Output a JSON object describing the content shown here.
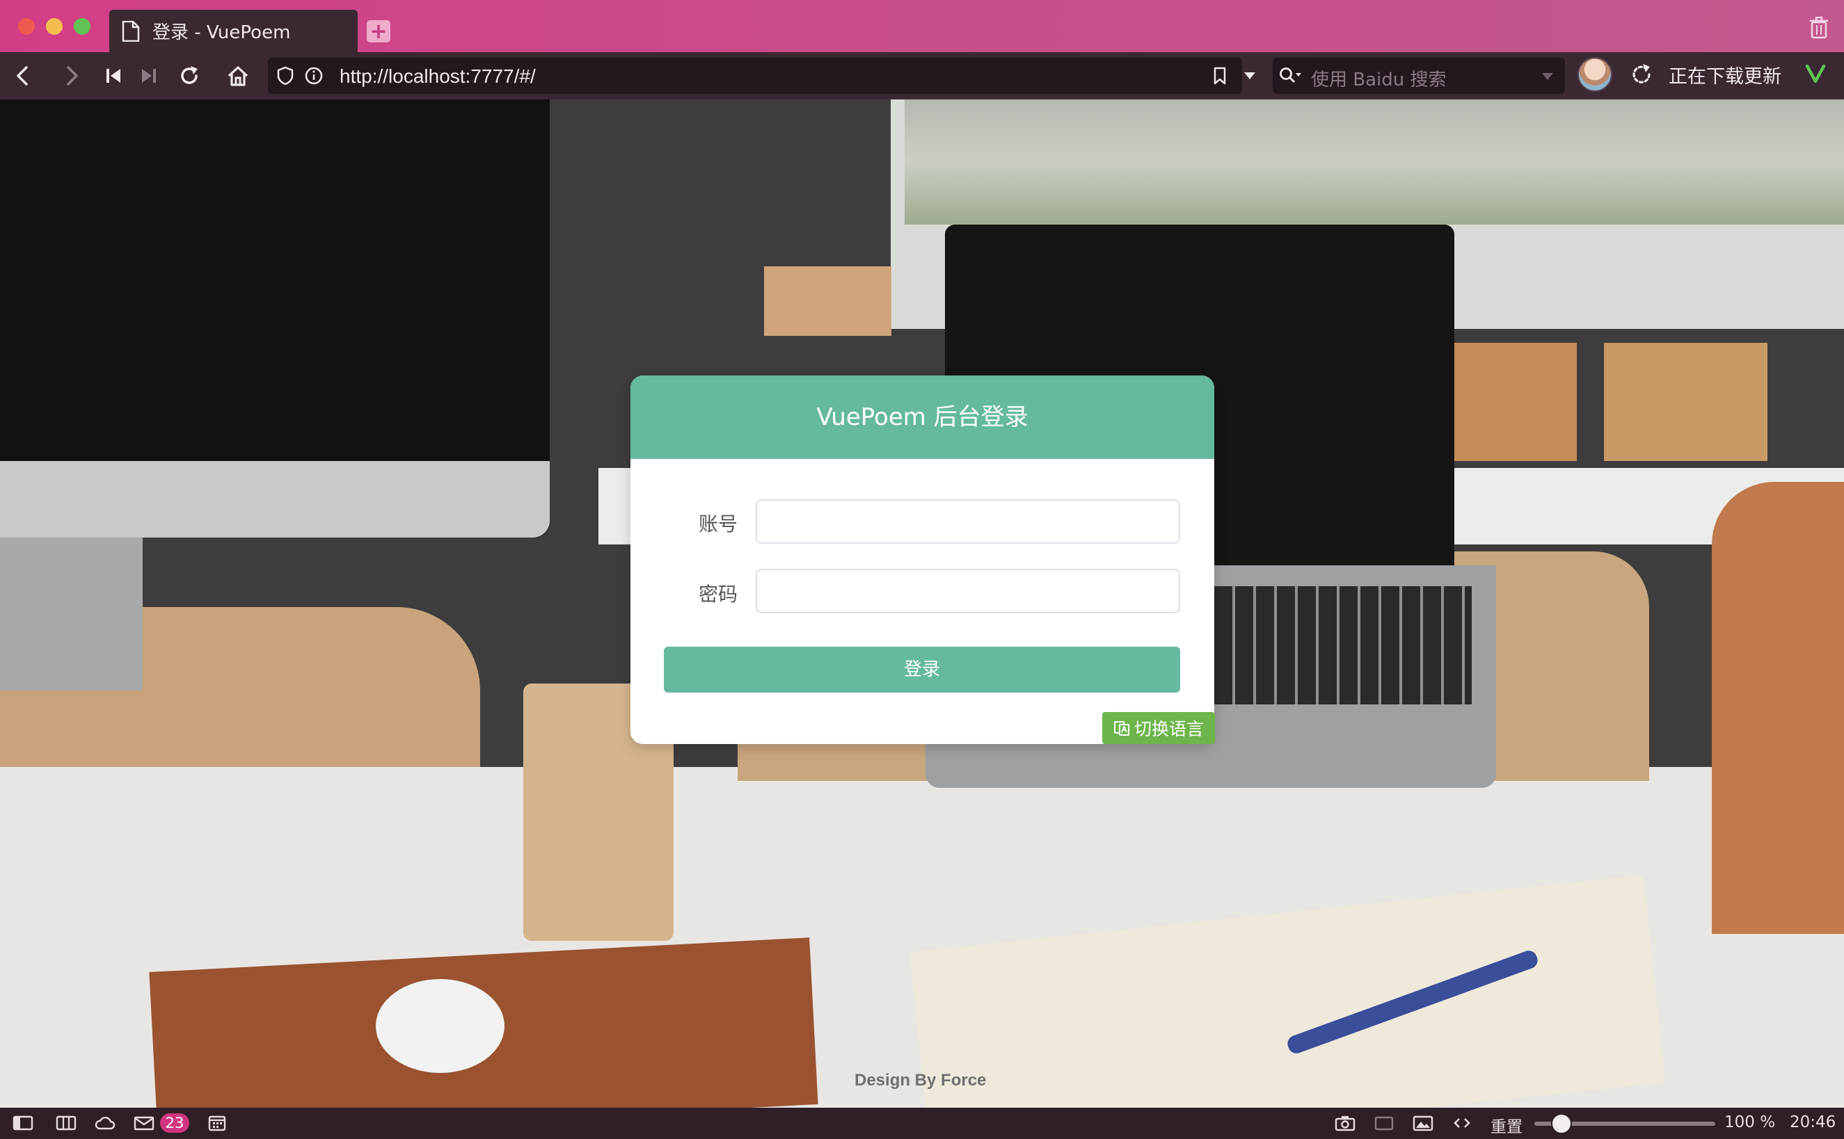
{
  "browser": {
    "tab_title": "登录 - VuePoem",
    "new_tab_label": "+",
    "url": "http://localhost:7777/#/",
    "search_placeholder": "使用 Baidu 搜索",
    "update_status": "正在下载更新",
    "icons": [
      "back-icon",
      "forward-icon",
      "first-icon",
      "last-icon",
      "reload-icon",
      "home-icon",
      "shield-icon",
      "info-icon",
      "bookmark-icon",
      "dropdown-icon",
      "search-icon",
      "avatar",
      "reload-status-icon",
      "vivaldi-logo"
    ]
  },
  "login": {
    "title": "VuePoem 后台登录",
    "account_label": "账号",
    "account_value": "",
    "password_label": "密码",
    "password_value": "",
    "submit_label": "登录",
    "switch_language_label": "切换语言",
    "accent_color": "#66b9a1",
    "language_button_color": "#6db64b"
  },
  "footer": {
    "credit": "Design By Force"
  },
  "statusbar": {
    "mail_count": "23",
    "reset_label": "重置",
    "zoom": "100 %",
    "time": "20:46",
    "zoom_level": 0.15
  }
}
